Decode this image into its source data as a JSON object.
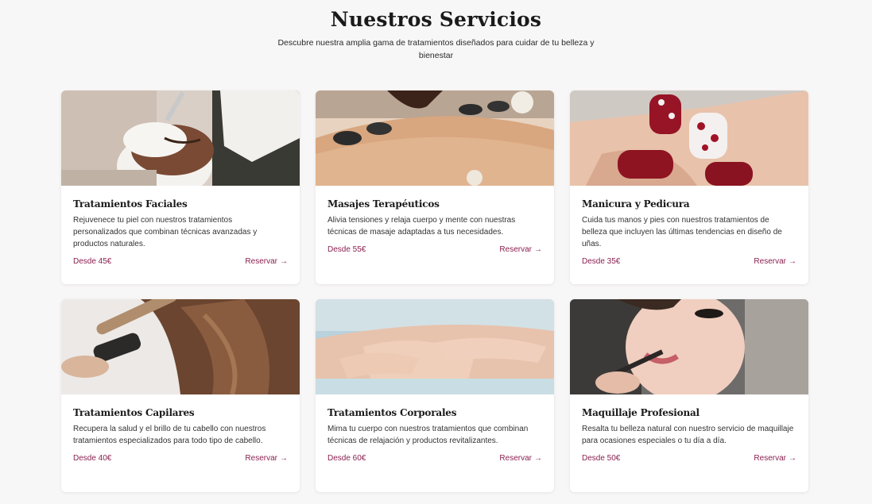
{
  "header": {
    "title": "Nuestros Servicios",
    "subtitle": "Descubre nuestra amplia gama de tratamientos diseñados para cuidar de tu belleza y bienestar"
  },
  "services": [
    {
      "title": "Tratamientos Faciales",
      "description": "Rejuvenece tu piel con nuestros tratamientos personalizados que combinan técnicas avanzadas y productos naturales.",
      "price": "Desde 45€",
      "cta": "Reservar",
      "image": "facial-treatment-photo"
    },
    {
      "title": "Masajes Terapéuticos",
      "description": "Alivia tensiones y relaja cuerpo y mente con nuestras técnicas de masaje adaptadas a tus necesidades.",
      "price": "Desde 55€",
      "cta": "Reservar",
      "image": "hot-stone-massage-photo"
    },
    {
      "title": "Manicura y Pedicura",
      "description": "Cuida tus manos y pies con nuestros tratamientos de belleza que incluyen las últimas tendencias en diseño de uñas.",
      "price": "Desde 35€",
      "cta": "Reservar",
      "image": "manicure-photo"
    },
    {
      "title": "Tratamientos Capilares",
      "description": "Recupera la salud y el brillo de tu cabello con nuestros tratamientos especializados para todo tipo de cabello.",
      "price": "Desde 40€",
      "cta": "Reservar",
      "image": "hair-curling-photo"
    },
    {
      "title": "Tratamientos Corporales",
      "description": "Mima tu cuerpo con nuestros tratamientos que combinan técnicas de relajación y productos revitalizantes.",
      "price": "Desde 60€",
      "cta": "Reservar",
      "image": "body-massage-photo"
    },
    {
      "title": "Maquillaje Profesional",
      "description": "Resalta tu belleza natural con nuestro servicio de maquillaje para ocasiones especiales o tu día a día.",
      "price": "Desde 50€",
      "cta": "Reservar",
      "image": "makeup-application-photo"
    }
  ],
  "colors": {
    "accent": "#8a2050",
    "background": "#f8f7f7",
    "card": "#ffffff"
  }
}
